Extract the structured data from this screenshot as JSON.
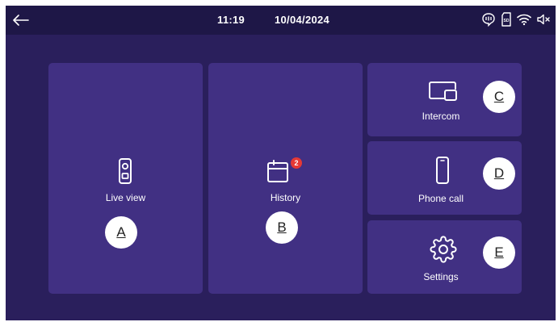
{
  "status_bar": {
    "time": "11:19",
    "date": "10/04/2024",
    "icons": [
      "back-arrow-icon",
      "voicemail-icon",
      "sd-card-icon",
      "wifi-icon",
      "speaker-muted-icon"
    ]
  },
  "tiles": {
    "live_view": {
      "label": "Live view",
      "marker": "A",
      "icon": "doorbell-icon"
    },
    "history": {
      "label": "History",
      "marker": "B",
      "icon": "calendar-icon",
      "badge": "2"
    },
    "intercom": {
      "label": "Intercom",
      "marker": "C",
      "icon": "intercom-monitor-icon"
    },
    "phone_call": {
      "label": "Phone call",
      "marker": "D",
      "icon": "phone-icon"
    },
    "settings": {
      "label": "Settings",
      "marker": "E",
      "icon": "gear-icon"
    }
  },
  "colors": {
    "background": "#2a1f5c",
    "status_bar": "#1e1747",
    "tile": "#413083",
    "badge": "#e53935"
  }
}
